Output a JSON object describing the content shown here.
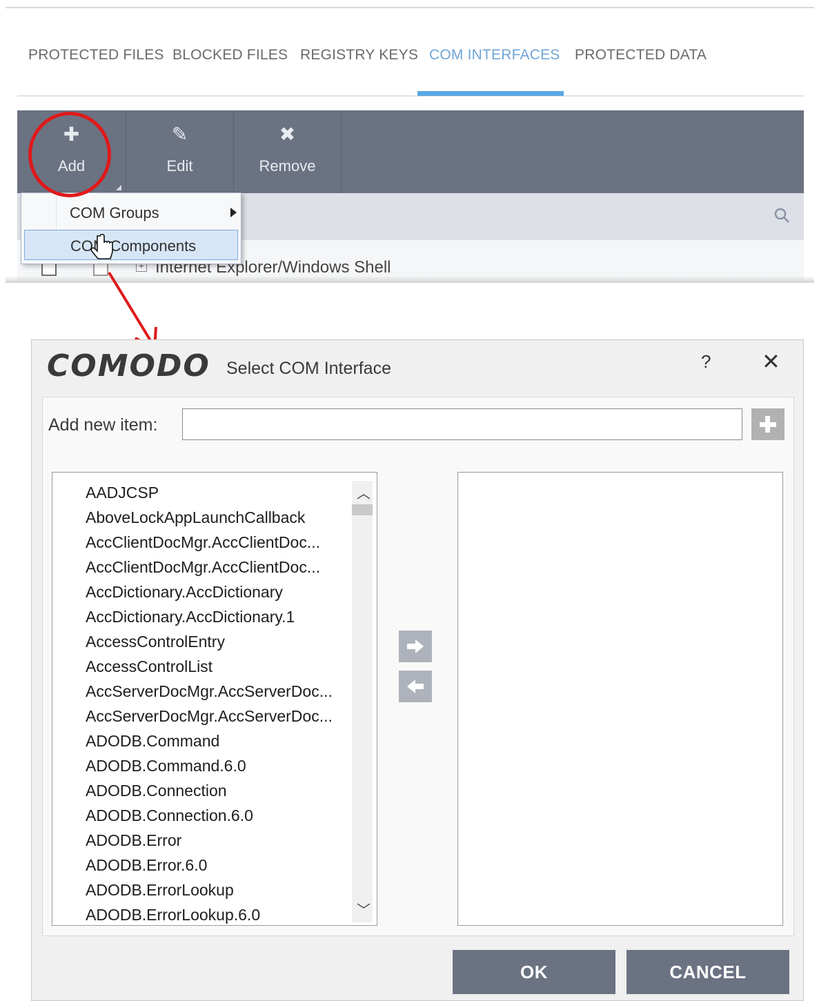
{
  "tabs": [
    "PROTECTED FILES",
    "BLOCKED FILES",
    "REGISTRY KEYS",
    "COM INTERFACES",
    "PROTECTED DATA"
  ],
  "toolbar": {
    "add_label": "Add",
    "edit_label": "Edit",
    "remove_label": "Remove",
    "color": "#6b7282"
  },
  "context_menu": {
    "items": [
      "COM Groups",
      "COM Components"
    ],
    "highlighted": "COM Components"
  },
  "behind_list": {
    "row_label": "Internet Explorer/Windows Shell"
  },
  "dialog": {
    "logo": "COMODO",
    "title": "Select COM Interface",
    "help": "?",
    "close": "✕",
    "new_item_label": "Add new item:",
    "new_item_value": "",
    "components": [
      "AADJCSP",
      "AboveLockAppLaunchCallback",
      "AccClientDocMgr.AccClientDoc...",
      "AccClientDocMgr.AccClientDoc...",
      "AccDictionary.AccDictionary",
      "AccDictionary.AccDictionary.1",
      "AccessControlEntry",
      "AccessControlList",
      "AccServerDocMgr.AccServerDoc...",
      "AccServerDocMgr.AccServerDoc...",
      "ADODB.Command",
      "ADODB.Command.6.0",
      "ADODB.Connection",
      "ADODB.Connection.6.0",
      "ADODB.Error",
      "ADODB.Error.6.0",
      "ADODB.ErrorLookup",
      "ADODB.ErrorLookup.6.0"
    ],
    "selected": [],
    "ok_label": "OK",
    "cancel_label": "CANCEL"
  },
  "colors": {
    "accent": "#5aa7e3",
    "annotation": "#e0191a",
    "button": "#6b7282"
  }
}
